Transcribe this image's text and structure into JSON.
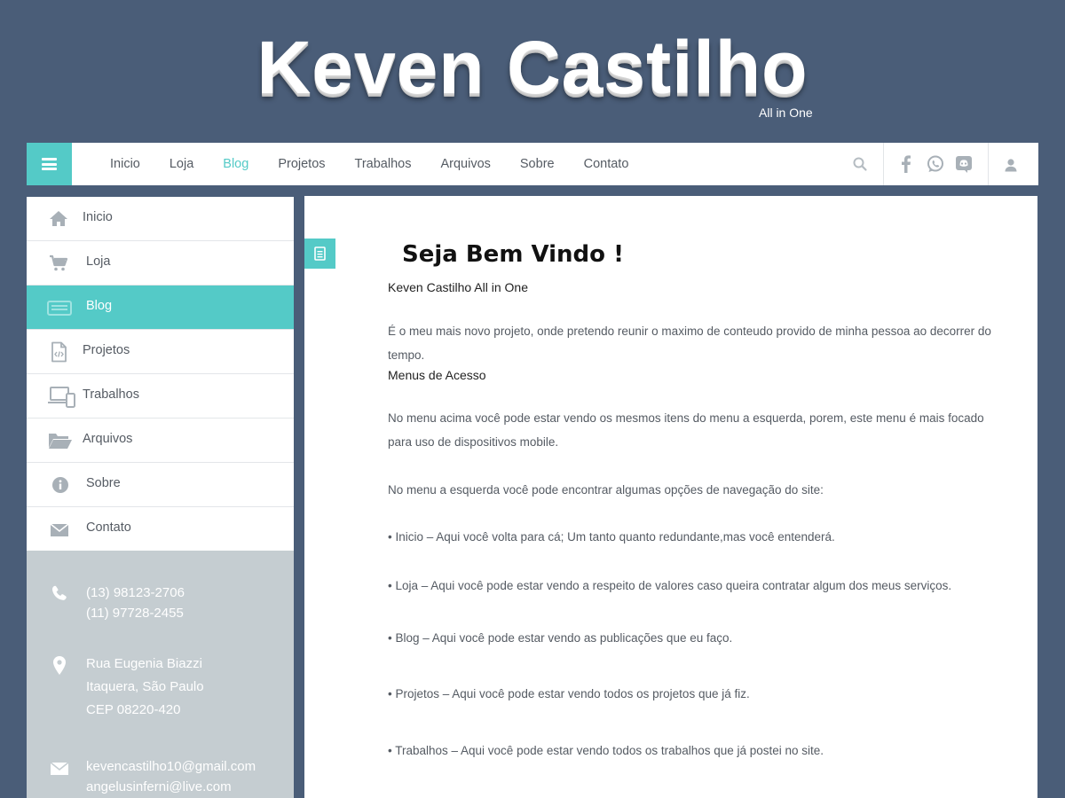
{
  "header": {
    "title": "Keven Castilho",
    "subtitle": "All in One"
  },
  "topnav": {
    "links": [
      "Inicio",
      "Loja",
      "Blog",
      "Projetos",
      "Trabalhos",
      "Arquivos",
      "Sobre",
      "Contato"
    ],
    "active": "Blog",
    "social_icons": [
      "facebook-icon",
      "whatsapp-icon",
      "discord-icon"
    ]
  },
  "sidebar": {
    "items": [
      {
        "label": "Inicio",
        "icon": "home-icon"
      },
      {
        "label": "Loja",
        "icon": "cart-icon"
      },
      {
        "label": "Blog",
        "icon": "blog-icon"
      },
      {
        "label": "Projetos",
        "icon": "code-file-icon"
      },
      {
        "label": "Trabalhos",
        "icon": "devices-icon"
      },
      {
        "label": "Arquivos",
        "icon": "folder-icon"
      },
      {
        "label": "Sobre",
        "icon": "info-icon"
      },
      {
        "label": "Contato",
        "icon": "mail-icon"
      }
    ],
    "active": "Blog",
    "contact": {
      "phones": [
        "(13) 98123-2706",
        "(11) 97728-2455"
      ],
      "address": [
        "Rua Eugenia Biazzi",
        "Itaquera, São Paulo",
        "CEP 08220-420"
      ],
      "emails": [
        "kevencastilho10@gmail.com",
        "angelusinferni@live.com"
      ]
    }
  },
  "post": {
    "title": "Seja Bem Vindo !",
    "heading": "Keven Castilho All in One",
    "intro": "É o meu mais novo projeto, onde pretendo reunir o maximo de conteudo provido de minha pessoa ao decorrer do tempo.",
    "menus_heading": "Menus de Acesso",
    "menus_text": "No menu acima você pode estar vendo os mesmos itens do menu a esquerda, porem, este menu é mais focado para uso de dispositivos mobile.",
    "left_menu_text": "No menu a esquerda você pode encontrar algumas opções de navegação do site:",
    "bullets": [
      "• Inicio – Aqui você volta para cá; Um tanto quanto redundante,mas você entenderá.",
      "• Loja – Aqui você pode estar vendo a respeito de valores caso queira contratar algum dos meus serviços.",
      "• Blog – Aqui você pode estar vendo as publicações que eu faço.",
      "• Projetos – Aqui você pode estar vendo todos os projetos que já fiz.",
      "• Trabalhos – Aqui você pode estar vendo todos os trabalhos que já postei no site."
    ]
  },
  "colors": {
    "background": "#4a5d78",
    "accent": "#54cac7",
    "sidebar_info_bg": "#c5cdd1"
  }
}
